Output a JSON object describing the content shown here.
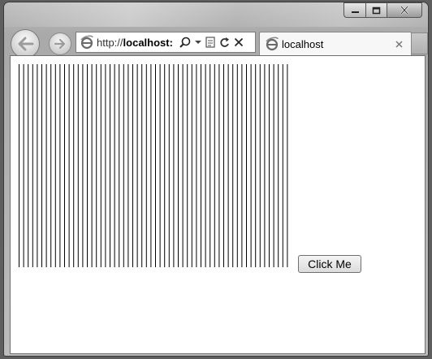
{
  "browser": {
    "address": {
      "scheme": "http://",
      "host": "localhost:"
    },
    "tab": {
      "title": "localhost"
    },
    "icons": {
      "back": "back-arrow-icon",
      "forward": "forward-arrow-icon",
      "page": "ie-page-icon",
      "search": "search-icon",
      "dropdown": "dropdown-arrow-icon",
      "compat": "compatibility-view-icon",
      "refresh": "refresh-icon",
      "stop": "stop-icon",
      "tab_close": "close-icon"
    }
  },
  "page": {
    "button_label": "Click Me",
    "vertical_line_count": 60,
    "line_color": "#000000"
  }
}
